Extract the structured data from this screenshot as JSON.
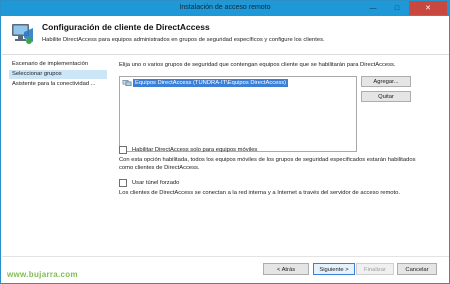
{
  "window": {
    "title": "Instalación de acceso remoto",
    "minimize": "—",
    "maximize": "□",
    "close": "✕"
  },
  "header": {
    "title": "Configuración de cliente de DirectAccess",
    "subtitle": "Habilite DirectAccess para equipos administrados en grupos de seguridad específicos y configure los clientes."
  },
  "nav": {
    "items": [
      {
        "label": "Escenario de implementación"
      },
      {
        "label": "Seleccionar grupos"
      },
      {
        "label": "Asistente para la conectividad ..."
      }
    ]
  },
  "main": {
    "intro": "Elija uno o varios grupos de seguridad que contengan equipos cliente que se habilitarán para DirectAccess.",
    "groups": [
      "Equipos DirectAccess (TUNDRA-IT\\Equipos DirectAccess)"
    ],
    "add_label": "Agregar...",
    "remove_label": "Quitar",
    "mobile_checkbox": "Habilitar DirectAccess solo para equipos móviles",
    "mobile_desc": "Con esta opción habilitada, todos los equipos móviles de los grupos de seguridad especificados estarán habilitados como clientes de DirectAccess.",
    "tunnel_checkbox": "Usar túnel forzado",
    "tunnel_desc": "Los clientes de DirectAccess se conectan a la red interna y a Internet a través del servidor de acceso remoto."
  },
  "footer": {
    "back": "< Atrás",
    "next": "Siguiente >",
    "finish": "Finalizar",
    "cancel": "Cancelar",
    "watermark": "www.bujarra.com"
  },
  "colors": {
    "titlebar": "#1e98d6",
    "close": "#c8473f",
    "selection": "#3c7fd6",
    "nav_selected": "#cde6f7"
  }
}
